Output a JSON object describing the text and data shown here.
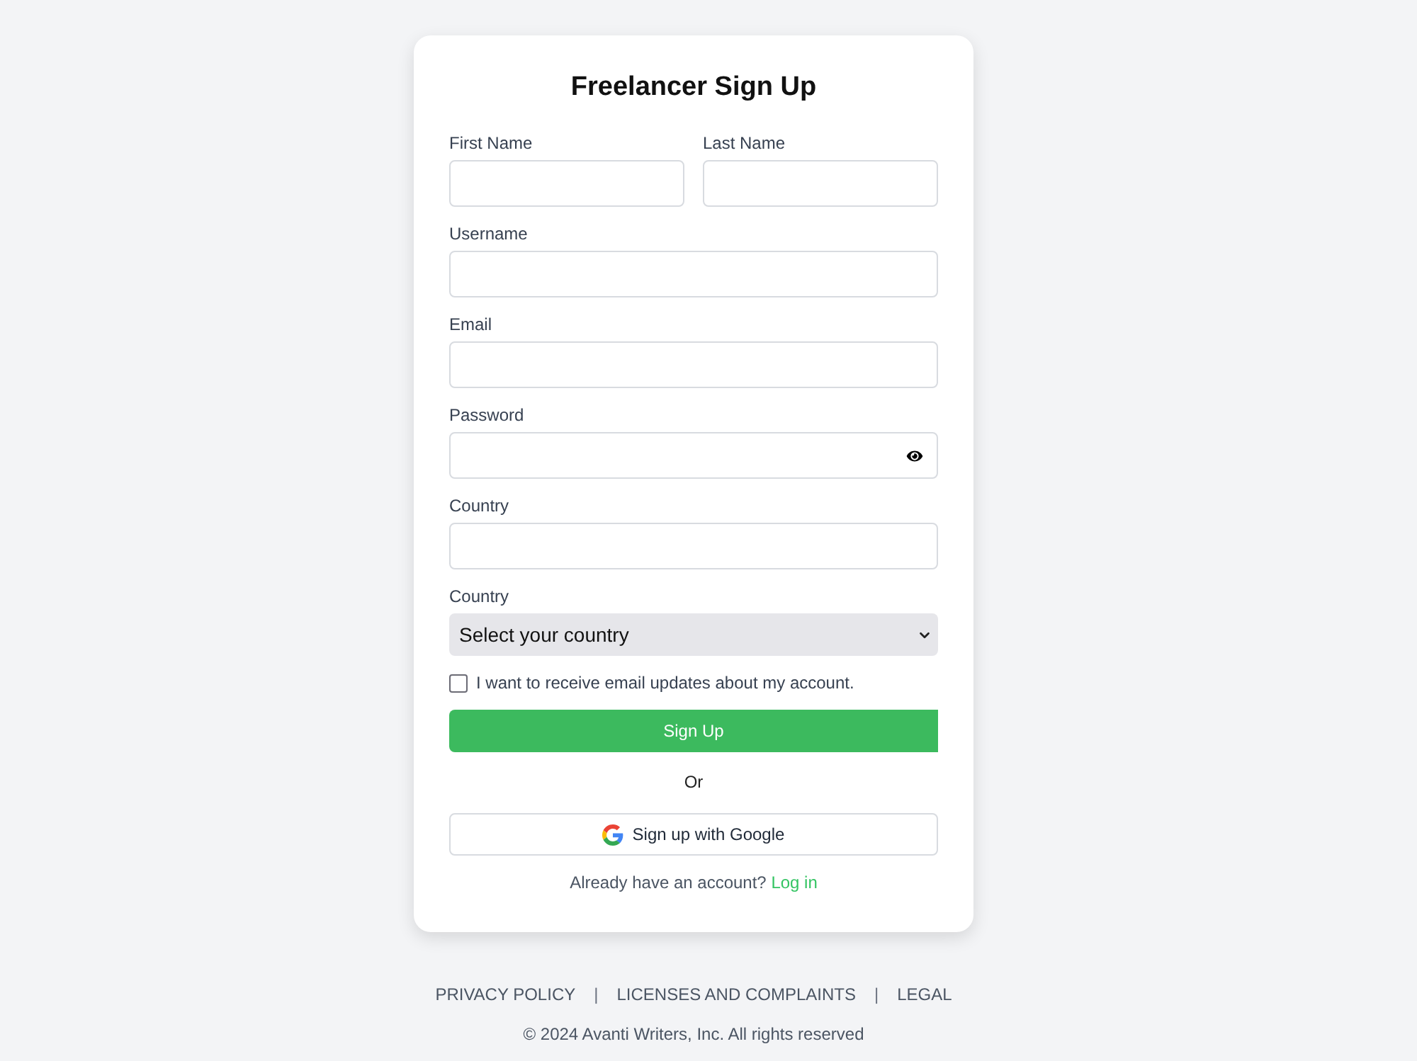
{
  "form": {
    "title": "Freelancer Sign Up",
    "name_row": [
      {
        "label": "First Name"
      },
      {
        "label": "Last Name"
      }
    ],
    "fields": [
      {
        "kind": "text",
        "label": "Username"
      },
      {
        "kind": "text",
        "label": "Email"
      },
      {
        "kind": "password",
        "label": "Password"
      },
      {
        "kind": "text",
        "label": "Country"
      },
      {
        "kind": "select",
        "label": "Country",
        "value": "Select your country"
      }
    ],
    "checkbox": {
      "label": "I want to receive email updates about my account.",
      "checked": false
    },
    "submit_button": "Sign Up",
    "divider_text": "Or",
    "google_button": "Sign up with Google",
    "login_prompt": {
      "text": "Already have an account?",
      "link": "Log in"
    }
  },
  "footer": {
    "items": [
      {
        "kind": "link",
        "text": "PRIVACY POLICY"
      },
      {
        "kind": "separator",
        "text": "|"
      },
      {
        "kind": "link",
        "text": "LICENSES AND COMPLAINTS"
      },
      {
        "kind": "separator",
        "text": "|"
      },
      {
        "kind": "link",
        "text": "LEGAL"
      }
    ],
    "copyright": "© 2024 Avanti Writers, Inc. All rights reserved"
  }
}
